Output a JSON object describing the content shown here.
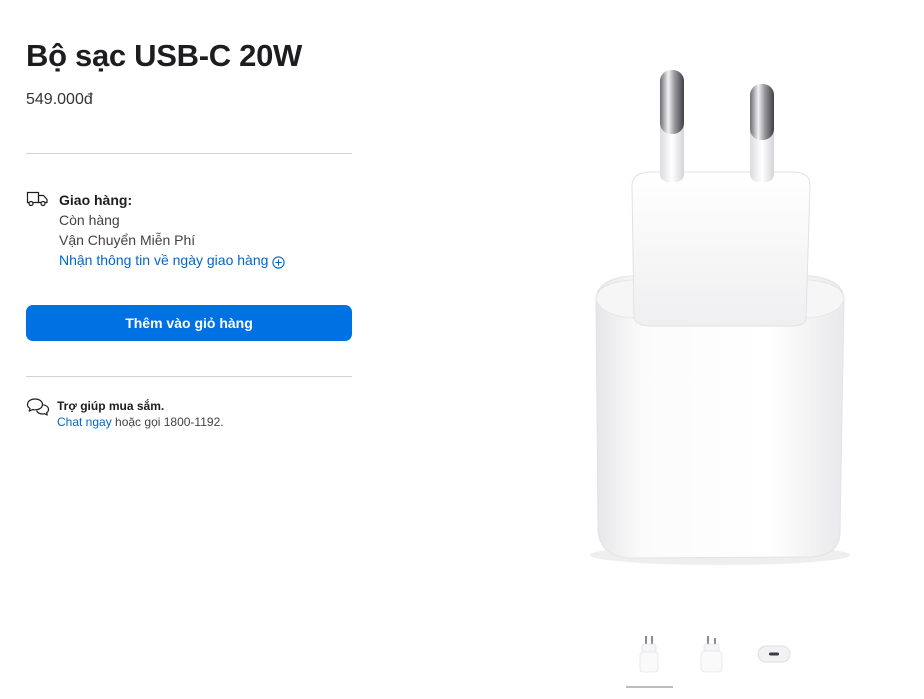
{
  "product": {
    "title": "Bộ sạc USB-C 20W",
    "price": "549.000đ"
  },
  "delivery": {
    "icon": "truck-icon",
    "heading": "Giao hàng:",
    "stock": "Còn hàng",
    "shipping": "Vận Chuyển Miễn Phí",
    "link_label": "Nhận thông tin về ngày giao hàng",
    "link_icon": "plus-circle-icon"
  },
  "cart": {
    "add_label": "Thêm vào giỏ hàng"
  },
  "help": {
    "icon": "chat-bubbles-icon",
    "heading": "Trợ giúp mua sắm.",
    "chat_label": "Chat ngay",
    "call_text": " hoặc gọi 1800-1192."
  },
  "gallery": {
    "selected_index": 0,
    "thumbnails": [
      "charger-front",
      "charger-angle",
      "charger-port"
    ]
  },
  "colors": {
    "accent": "#0071e3",
    "link": "#0066cc",
    "divider": "#d2d2d7"
  }
}
